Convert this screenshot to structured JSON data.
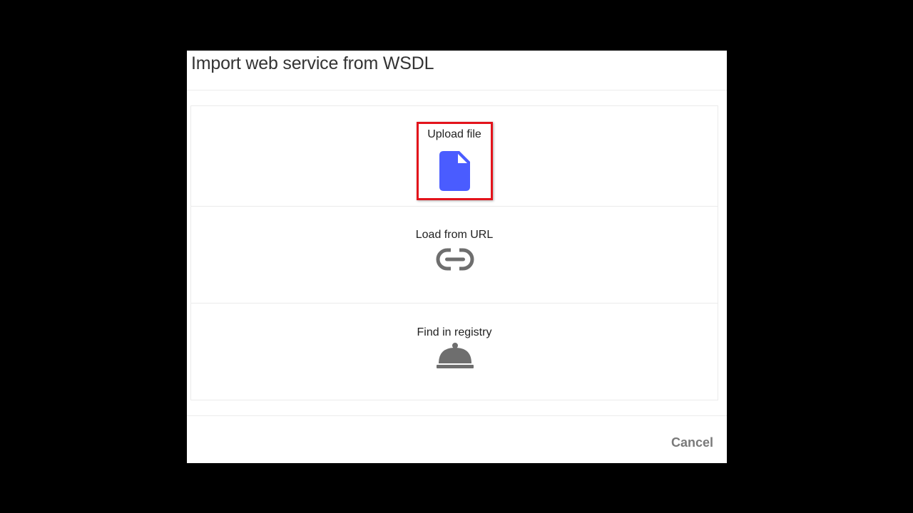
{
  "dialog": {
    "title": "Import web service from WSDL",
    "cancel_label": "Cancel"
  },
  "options": [
    {
      "label": "Upload file",
      "icon": "file-icon",
      "highlighted": true
    },
    {
      "label": "Load from URL",
      "icon": "link-icon",
      "highlighted": false
    },
    {
      "label": "Find in registry",
      "icon": "service-bell-icon",
      "highlighted": false
    }
  ],
  "colors": {
    "background": "#000000",
    "dialog": "#ffffff",
    "file_icon": "#4a5cff",
    "gray_icon": "#6e6e6e",
    "highlight": "#e3131b",
    "cancel": "#7a7a7a"
  }
}
